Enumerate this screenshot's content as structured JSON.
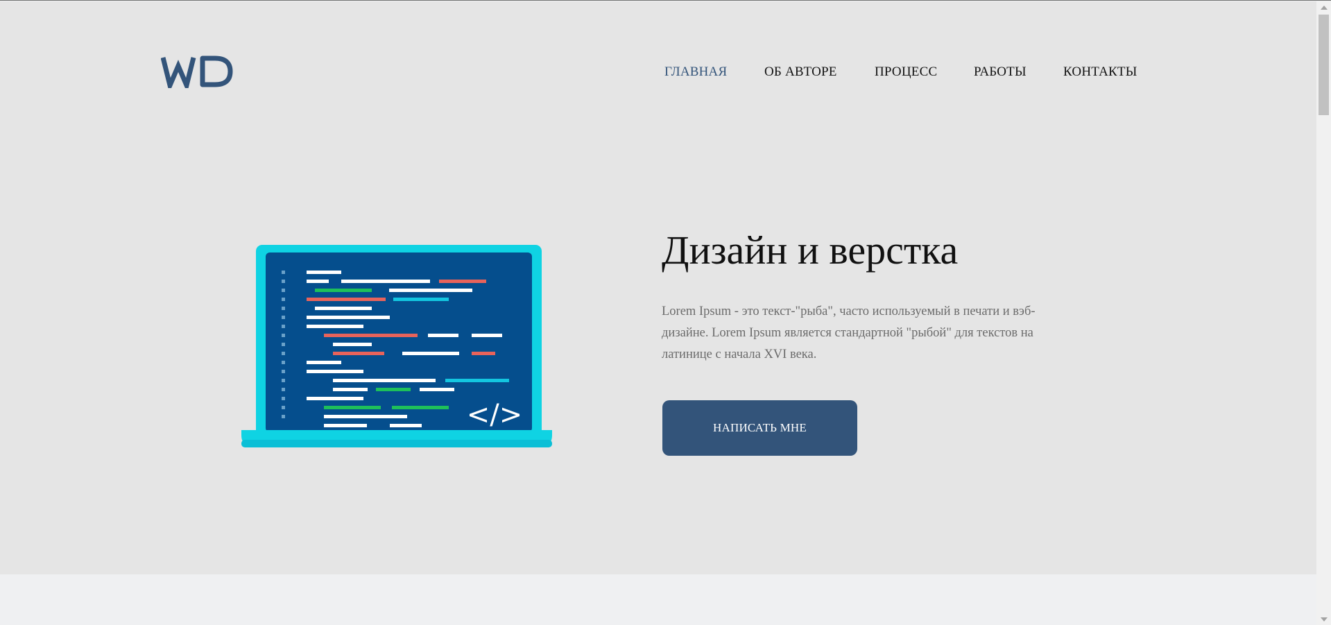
{
  "logo": {
    "text": "WD",
    "color": "#33547a"
  },
  "nav": {
    "items": [
      {
        "label": "ГЛАВНАЯ",
        "active": true
      },
      {
        "label": "ОБ АВТОРЕ",
        "active": false
      },
      {
        "label": "ПРОЦЕСС",
        "active": false
      },
      {
        "label": "РАБОТЫ",
        "active": false
      },
      {
        "label": "КОНТАКТЫ",
        "active": false
      }
    ]
  },
  "hero": {
    "title": "Дизайн и верстка",
    "description": "Lorem Ipsum - это текст-\"рыба\", часто используемый в печати и вэб-дизайне. Lorem Ipsum является стандартной \"рыбой\" для текстов на латинице с начала XVI века.",
    "button_label": "НАПИСАТЬ МНЕ",
    "illustration": "laptop-code-icon",
    "code_symbol": "</>"
  },
  "colors": {
    "accent": "#33547a",
    "hero_bg": "#e5e5e5",
    "page_bg": "#eff0f2",
    "laptop_frame": "#0fd3e3",
    "laptop_screen": "#054e8d",
    "code_red": "#e8635b",
    "code_green": "#1ec05a",
    "code_cyan": "#13c6e0"
  }
}
